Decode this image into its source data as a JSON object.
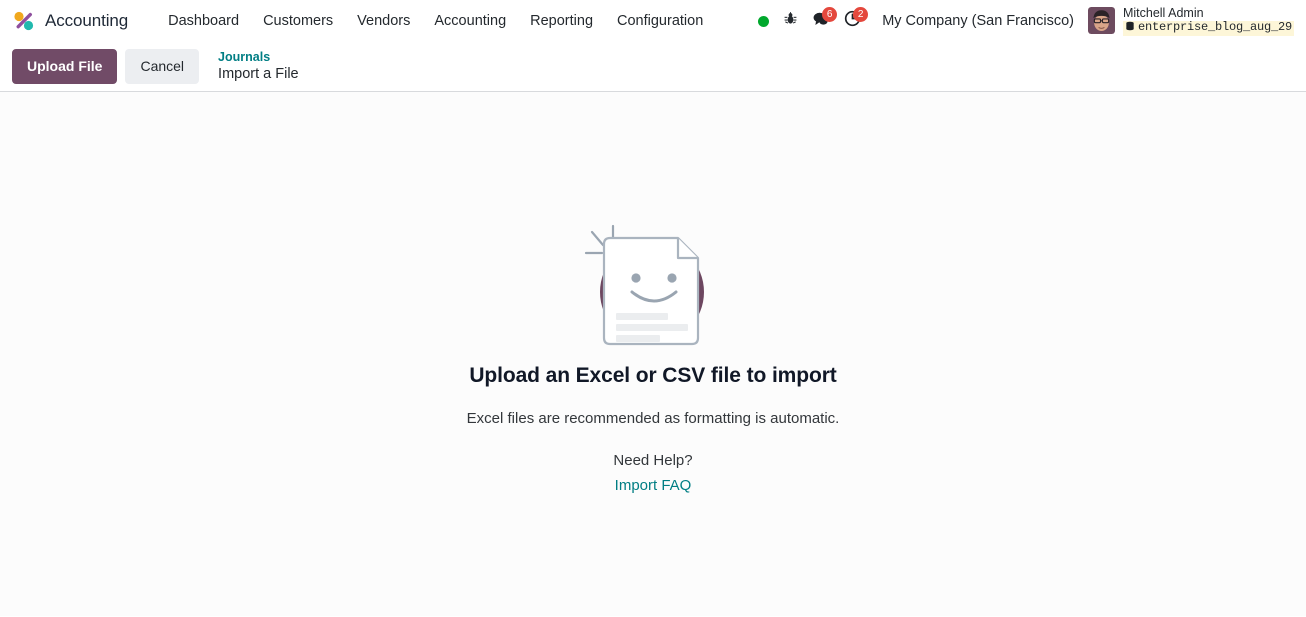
{
  "navbar": {
    "brand": {
      "logo_icon": "odoo-logo-icon",
      "app_name": "Accounting"
    },
    "menu_items": [
      {
        "label": "Dashboard"
      },
      {
        "label": "Customers"
      },
      {
        "label": "Vendors"
      },
      {
        "label": "Accounting"
      },
      {
        "label": "Reporting"
      },
      {
        "label": "Configuration"
      }
    ],
    "systray": {
      "status_dot": {
        "icon": "green-status-dot-icon",
        "color": "#00a82d"
      },
      "debug": {
        "icon": "bug-icon"
      },
      "messages": {
        "icon": "messaging-icon",
        "count": "6"
      },
      "activities": {
        "icon": "activity-clock-icon",
        "count": "2"
      },
      "company": "My Company (San Francisco)",
      "user": {
        "avatar_icon": "user-avatar",
        "name": "Mitchell Admin",
        "database_icon": "database-icon",
        "database": "enterprise_blog_aug_29"
      }
    }
  },
  "control_panel": {
    "upload_label": "Upload File",
    "cancel_label": "Cancel",
    "breadcrumb_parent": "Journals",
    "breadcrumb_current": "Import a File"
  },
  "main": {
    "illustration_icon": "smiling-document-illustration",
    "headline": "Upload an Excel or CSV file to import",
    "subtext": "Excel files are recommended as formatting is automatic.",
    "help_label": "Need Help?",
    "faq_link": "Import FAQ"
  },
  "colors": {
    "primary": "#714b67",
    "link": "#017e84",
    "badge": "#e4483d",
    "status_green": "#00a82d",
    "content_bg": "#fcfcfc"
  }
}
